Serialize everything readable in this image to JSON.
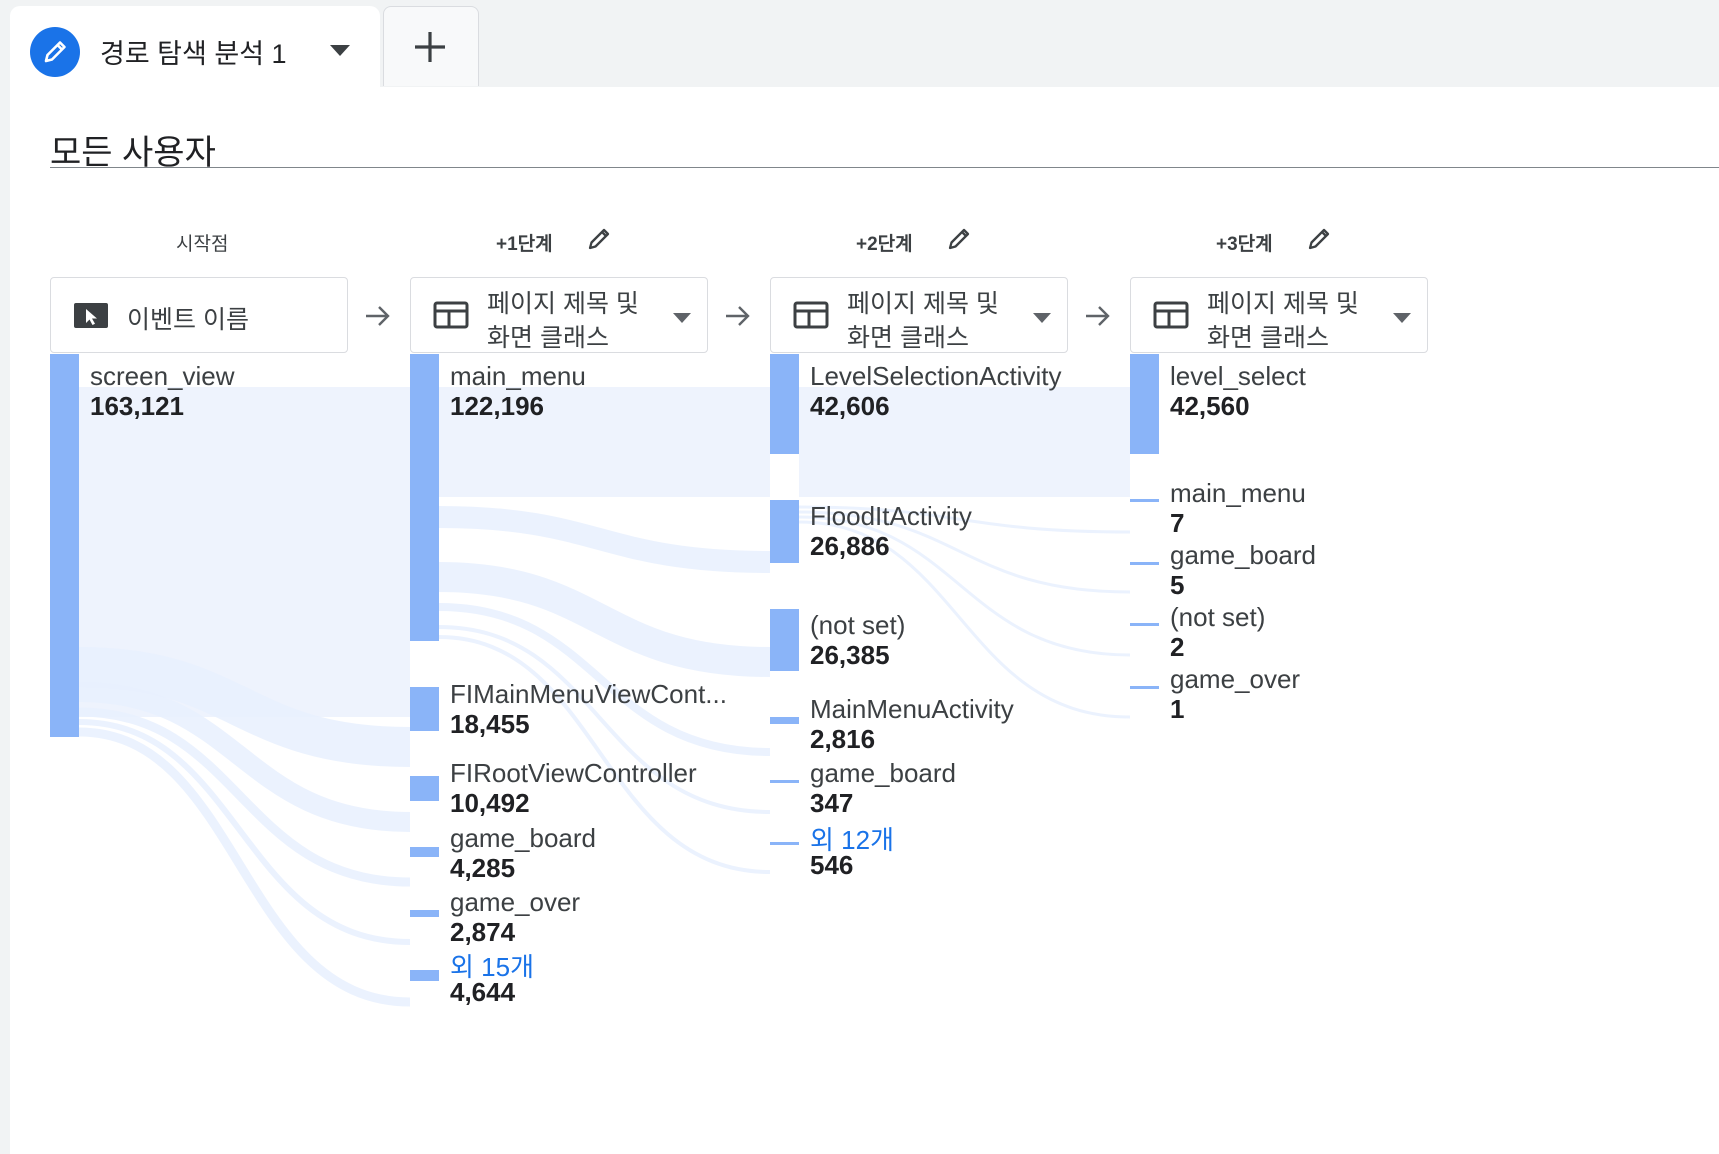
{
  "tabs": [
    {
      "label": "경로 탐색 분석 1",
      "icon": "pencil-icon",
      "active": true
    }
  ],
  "add_tab_icon": "plus-icon",
  "segment": "모든 사용자",
  "steps": [
    {
      "label": "시작점",
      "dimension": "이벤트 이름",
      "dimension_icon": "cursor-icon",
      "editable": false
    },
    {
      "label": "+1단계",
      "dimension_line1": "페이지 제목 및",
      "dimension_line2": "화면 클래스",
      "dimension_icon": "table-icon",
      "editable": true
    },
    {
      "label": "+2단계",
      "dimension_line1": "페이지 제목 및",
      "dimension_line2": "화면 클래스",
      "dimension_icon": "table-icon",
      "editable": true
    },
    {
      "label": "+3단계",
      "dimension_line1": "페이지 제목 및",
      "dimension_line2": "화면 클래스",
      "dimension_icon": "table-icon",
      "editable": true
    }
  ],
  "columns": [
    {
      "nodes": [
        {
          "label": "screen_view",
          "value": "163,121"
        }
      ]
    },
    {
      "nodes": [
        {
          "label": "main_menu",
          "value": "122,196"
        },
        {
          "label": "FIMainMenuViewCont...",
          "value": "18,455"
        },
        {
          "label": "FIRootViewController",
          "value": "10,492"
        },
        {
          "label": "game_board",
          "value": "4,285"
        },
        {
          "label": "game_over",
          "value": "2,874"
        },
        {
          "label": "외 15개",
          "value": "4,644",
          "more": true
        }
      ]
    },
    {
      "nodes": [
        {
          "label": "LevelSelectionActivity",
          "value": "42,606"
        },
        {
          "label": "FloodItActivity",
          "value": "26,886"
        },
        {
          "label": "(not set)",
          "value": "26,385"
        },
        {
          "label": "MainMenuActivity",
          "value": "2,816"
        },
        {
          "label": "game_board",
          "value": "347"
        },
        {
          "label": "외 12개",
          "value": "546",
          "more": true
        }
      ]
    },
    {
      "nodes": [
        {
          "label": "level_select",
          "value": "42,560"
        },
        {
          "label": "main_menu",
          "value": "7"
        },
        {
          "label": "game_board",
          "value": "5"
        },
        {
          "label": "(not set)",
          "value": "2"
        },
        {
          "label": "game_over",
          "value": "1"
        }
      ]
    }
  ],
  "colors": {
    "node": "#8ab4f8",
    "highlight": "#eef3fd",
    "link": "#e8f0fe",
    "accent": "#1a73e8"
  }
}
